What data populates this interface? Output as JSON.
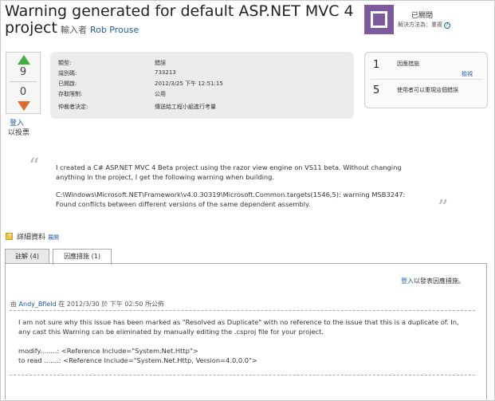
{
  "header": {
    "title": "Warning generated for default ASP.NET MVC 4 project",
    "entered_by_label": "輸入者",
    "author": "Rob Prouse"
  },
  "status": {
    "label": "已關閉",
    "resolution": "解決方法為：重複"
  },
  "votes": {
    "up_count": "9",
    "down_count": "0",
    "login_link": "登入",
    "login_suffix": "以投票"
  },
  "details": {
    "rows": [
      {
        "label": "類型:",
        "value": "錯誤"
      },
      {
        "label": "識別碼:",
        "value": "733213"
      },
      {
        "label": "已開啟:",
        "value": "2012/3/25 下午 12:51:15"
      },
      {
        "label": "存取限制:",
        "value": "公用"
      },
      {
        "label": "仲裁者決定:",
        "value": "傳送給工程小組進行考量"
      }
    ]
  },
  "workarounds": {
    "count": "1",
    "label": "因應措施",
    "view_link": "檢視",
    "repro_count": "5",
    "repro_label": "使用者可以重現這個錯誤"
  },
  "description": {
    "paragraph1_line1": "I created a C# ASP.NET MVC 4 Beta project using the razor view engine on VS11 beta. Without changing",
    "paragraph1_line2": "anything in the project, I get the following warning when building.",
    "paragraph2_line1": "C:\\Windows\\Microsoft.NET\\Framework\\v4.0.30319\\Microsoft.Common.targets(1546,5): warning MSB3247:",
    "paragraph2_line2": "Found conflicts between different versions of the same dependent assembly."
  },
  "more_info": {
    "label": "詳細資料",
    "expand_link": "展開"
  },
  "tabs": [
    {
      "label": "註解 (4)"
    },
    {
      "label": "因應措施 (1)"
    }
  ],
  "workaround_panel": {
    "login_link": "登入",
    "login_suffix": "以發表因應措施。",
    "meta_prefix": "由",
    "user": "Andy_Bfield",
    "meta_suffix": "在 2012/3/30 於 下午 02:50 所公佈",
    "line1": "I am not sure why this issue has been marked as \"Resolved as Duplicate\" with no reference to the issue that this is a duplicate of. In,",
    "line2": "any cast this Warning can be eliminated by manually editing the .csproj file for your project.",
    "line3": "modify........: <Reference Include=\"System.Net.Http\">",
    "line4": "to read .......: <Reference Include=\"System.Net.Http, Version=4.0.0.0\">"
  },
  "colors": {
    "accent_link": "#1e5aa6",
    "status_closed": "#7b5a9e",
    "vote_up": "#3fae3f",
    "vote_down": "#e06a2c"
  }
}
